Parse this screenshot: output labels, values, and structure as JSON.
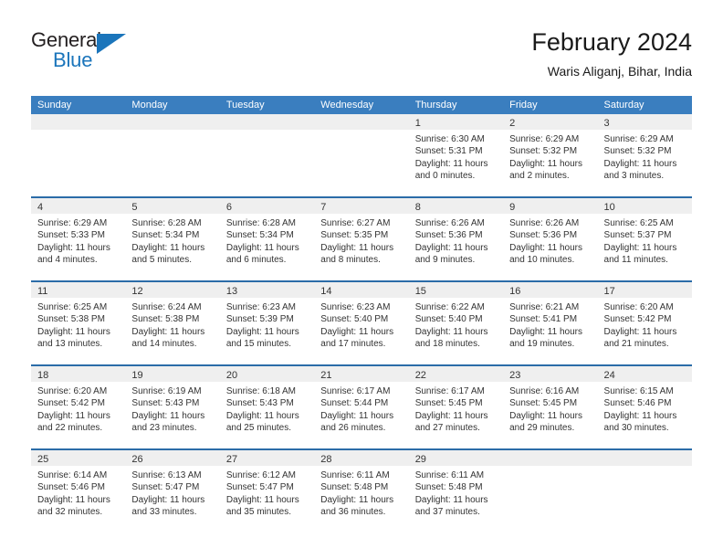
{
  "brand": {
    "name_primary": "General",
    "name_secondary": "Blue",
    "logo_icon": "blue-triangle-icon",
    "color_blue": "#1b75bb",
    "color_dark": "#231f20"
  },
  "header": {
    "title": "February 2024",
    "location": "Waris Aliganj, Bihar, India"
  },
  "theme": {
    "header_bg": "#3a7ebf",
    "row_divider": "#2b6ca8",
    "date_strip_bg": "#efefef",
    "text": "#333333"
  },
  "calendar": {
    "weekdays": [
      "Sunday",
      "Monday",
      "Tuesday",
      "Wednesday",
      "Thursday",
      "Friday",
      "Saturday"
    ],
    "weeks": [
      [
        {
          "date": "",
          "sunrise": "",
          "sunset": "",
          "daylight_line1": "",
          "daylight_line2": ""
        },
        {
          "date": "",
          "sunrise": "",
          "sunset": "",
          "daylight_line1": "",
          "daylight_line2": ""
        },
        {
          "date": "",
          "sunrise": "",
          "sunset": "",
          "daylight_line1": "",
          "daylight_line2": ""
        },
        {
          "date": "",
          "sunrise": "",
          "sunset": "",
          "daylight_line1": "",
          "daylight_line2": ""
        },
        {
          "date": "1",
          "sunrise": "Sunrise: 6:30 AM",
          "sunset": "Sunset: 5:31 PM",
          "daylight_line1": "Daylight: 11 hours",
          "daylight_line2": "and 0 minutes."
        },
        {
          "date": "2",
          "sunrise": "Sunrise: 6:29 AM",
          "sunset": "Sunset: 5:32 PM",
          "daylight_line1": "Daylight: 11 hours",
          "daylight_line2": "and 2 minutes."
        },
        {
          "date": "3",
          "sunrise": "Sunrise: 6:29 AM",
          "sunset": "Sunset: 5:32 PM",
          "daylight_line1": "Daylight: 11 hours",
          "daylight_line2": "and 3 minutes."
        }
      ],
      [
        {
          "date": "4",
          "sunrise": "Sunrise: 6:29 AM",
          "sunset": "Sunset: 5:33 PM",
          "daylight_line1": "Daylight: 11 hours",
          "daylight_line2": "and 4 minutes."
        },
        {
          "date": "5",
          "sunrise": "Sunrise: 6:28 AM",
          "sunset": "Sunset: 5:34 PM",
          "daylight_line1": "Daylight: 11 hours",
          "daylight_line2": "and 5 minutes."
        },
        {
          "date": "6",
          "sunrise": "Sunrise: 6:28 AM",
          "sunset": "Sunset: 5:34 PM",
          "daylight_line1": "Daylight: 11 hours",
          "daylight_line2": "and 6 minutes."
        },
        {
          "date": "7",
          "sunrise": "Sunrise: 6:27 AM",
          "sunset": "Sunset: 5:35 PM",
          "daylight_line1": "Daylight: 11 hours",
          "daylight_line2": "and 8 minutes."
        },
        {
          "date": "8",
          "sunrise": "Sunrise: 6:26 AM",
          "sunset": "Sunset: 5:36 PM",
          "daylight_line1": "Daylight: 11 hours",
          "daylight_line2": "and 9 minutes."
        },
        {
          "date": "9",
          "sunrise": "Sunrise: 6:26 AM",
          "sunset": "Sunset: 5:36 PM",
          "daylight_line1": "Daylight: 11 hours",
          "daylight_line2": "and 10 minutes."
        },
        {
          "date": "10",
          "sunrise": "Sunrise: 6:25 AM",
          "sunset": "Sunset: 5:37 PM",
          "daylight_line1": "Daylight: 11 hours",
          "daylight_line2": "and 11 minutes."
        }
      ],
      [
        {
          "date": "11",
          "sunrise": "Sunrise: 6:25 AM",
          "sunset": "Sunset: 5:38 PM",
          "daylight_line1": "Daylight: 11 hours",
          "daylight_line2": "and 13 minutes."
        },
        {
          "date": "12",
          "sunrise": "Sunrise: 6:24 AM",
          "sunset": "Sunset: 5:38 PM",
          "daylight_line1": "Daylight: 11 hours",
          "daylight_line2": "and 14 minutes."
        },
        {
          "date": "13",
          "sunrise": "Sunrise: 6:23 AM",
          "sunset": "Sunset: 5:39 PM",
          "daylight_line1": "Daylight: 11 hours",
          "daylight_line2": "and 15 minutes."
        },
        {
          "date": "14",
          "sunrise": "Sunrise: 6:23 AM",
          "sunset": "Sunset: 5:40 PM",
          "daylight_line1": "Daylight: 11 hours",
          "daylight_line2": "and 17 minutes."
        },
        {
          "date": "15",
          "sunrise": "Sunrise: 6:22 AM",
          "sunset": "Sunset: 5:40 PM",
          "daylight_line1": "Daylight: 11 hours",
          "daylight_line2": "and 18 minutes."
        },
        {
          "date": "16",
          "sunrise": "Sunrise: 6:21 AM",
          "sunset": "Sunset: 5:41 PM",
          "daylight_line1": "Daylight: 11 hours",
          "daylight_line2": "and 19 minutes."
        },
        {
          "date": "17",
          "sunrise": "Sunrise: 6:20 AM",
          "sunset": "Sunset: 5:42 PM",
          "daylight_line1": "Daylight: 11 hours",
          "daylight_line2": "and 21 minutes."
        }
      ],
      [
        {
          "date": "18",
          "sunrise": "Sunrise: 6:20 AM",
          "sunset": "Sunset: 5:42 PM",
          "daylight_line1": "Daylight: 11 hours",
          "daylight_line2": "and 22 minutes."
        },
        {
          "date": "19",
          "sunrise": "Sunrise: 6:19 AM",
          "sunset": "Sunset: 5:43 PM",
          "daylight_line1": "Daylight: 11 hours",
          "daylight_line2": "and 23 minutes."
        },
        {
          "date": "20",
          "sunrise": "Sunrise: 6:18 AM",
          "sunset": "Sunset: 5:43 PM",
          "daylight_line1": "Daylight: 11 hours",
          "daylight_line2": "and 25 minutes."
        },
        {
          "date": "21",
          "sunrise": "Sunrise: 6:17 AM",
          "sunset": "Sunset: 5:44 PM",
          "daylight_line1": "Daylight: 11 hours",
          "daylight_line2": "and 26 minutes."
        },
        {
          "date": "22",
          "sunrise": "Sunrise: 6:17 AM",
          "sunset": "Sunset: 5:45 PM",
          "daylight_line1": "Daylight: 11 hours",
          "daylight_line2": "and 27 minutes."
        },
        {
          "date": "23",
          "sunrise": "Sunrise: 6:16 AM",
          "sunset": "Sunset: 5:45 PM",
          "daylight_line1": "Daylight: 11 hours",
          "daylight_line2": "and 29 minutes."
        },
        {
          "date": "24",
          "sunrise": "Sunrise: 6:15 AM",
          "sunset": "Sunset: 5:46 PM",
          "daylight_line1": "Daylight: 11 hours",
          "daylight_line2": "and 30 minutes."
        }
      ],
      [
        {
          "date": "25",
          "sunrise": "Sunrise: 6:14 AM",
          "sunset": "Sunset: 5:46 PM",
          "daylight_line1": "Daylight: 11 hours",
          "daylight_line2": "and 32 minutes."
        },
        {
          "date": "26",
          "sunrise": "Sunrise: 6:13 AM",
          "sunset": "Sunset: 5:47 PM",
          "daylight_line1": "Daylight: 11 hours",
          "daylight_line2": "and 33 minutes."
        },
        {
          "date": "27",
          "sunrise": "Sunrise: 6:12 AM",
          "sunset": "Sunset: 5:47 PM",
          "daylight_line1": "Daylight: 11 hours",
          "daylight_line2": "and 35 minutes."
        },
        {
          "date": "28",
          "sunrise": "Sunrise: 6:11 AM",
          "sunset": "Sunset: 5:48 PM",
          "daylight_line1": "Daylight: 11 hours",
          "daylight_line2": "and 36 minutes."
        },
        {
          "date": "29",
          "sunrise": "Sunrise: 6:11 AM",
          "sunset": "Sunset: 5:48 PM",
          "daylight_line1": "Daylight: 11 hours",
          "daylight_line2": "and 37 minutes."
        },
        {
          "date": "",
          "sunrise": "",
          "sunset": "",
          "daylight_line1": "",
          "daylight_line2": ""
        },
        {
          "date": "",
          "sunrise": "",
          "sunset": "",
          "daylight_line1": "",
          "daylight_line2": ""
        }
      ]
    ]
  }
}
